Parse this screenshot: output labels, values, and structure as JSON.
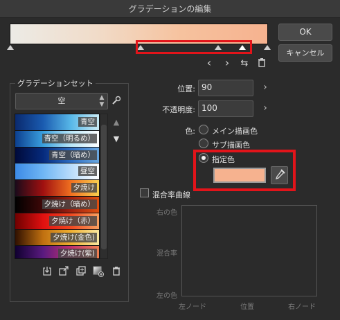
{
  "window": {
    "title": "グラデーションの編集"
  },
  "buttons": {
    "ok": "OK",
    "cancel": "キャンセル"
  },
  "gradient_preview": {
    "colors": [
      "#ecebe6",
      "#f1dcc9",
      "#f6c29e",
      "#f6b28f"
    ]
  },
  "gradient_set": {
    "title": "グラデーションセット",
    "selected": "空",
    "items": [
      {
        "label": "青空",
        "colors": [
          "#0a2a6e",
          "#1a5bb0",
          "#58b8e8",
          "#c9ebf5"
        ]
      },
      {
        "label": "青空（明るめ）",
        "colors": [
          "#0c3f8f",
          "#3aa0df",
          "#b8e6f7",
          "#ffffff"
        ]
      },
      {
        "label": "青空（暗め）",
        "colors": [
          "#000a3a",
          "#062a7c",
          "#2c6cc2",
          "#6aa8e0"
        ]
      },
      {
        "label": "昼空",
        "colors": [
          "#3c8ae6",
          "#6fb6f4",
          "#b9dcfb",
          "#ffffff"
        ]
      },
      {
        "label": "夕焼け",
        "colors": [
          "#1a0a1a",
          "#a01010",
          "#f07020",
          "#f8d050"
        ]
      },
      {
        "label": "夕焼け（暗め）",
        "colors": [
          "#000000",
          "#400808",
          "#a02010",
          "#e05010"
        ]
      },
      {
        "label": "夕焼け（赤）",
        "colors": [
          "#700000",
          "#e01010",
          "#f04820",
          "#f8a060"
        ]
      },
      {
        "label": "夕焼け(金色)",
        "colors": [
          "#301000",
          "#c07010",
          "#f0b030",
          "#f8e8a0"
        ]
      },
      {
        "label": "夕焼け(紫)",
        "colors": [
          "#100030",
          "#5a1a80",
          "#c03070",
          "#f08050"
        ]
      }
    ]
  },
  "position": {
    "label": "位置:",
    "value": "90"
  },
  "opacity": {
    "label": "不透明度:",
    "value": "100"
  },
  "color": {
    "label": "色:",
    "options": [
      "メイン描画色",
      "サブ描画色",
      "指定色"
    ],
    "selected": "指定色",
    "specified_hex": "#f6b28f"
  },
  "blend_curve": {
    "checkbox_label": "混合率曲線",
    "y_top": "右の色",
    "y_mid": "混合率",
    "y_bottom": "左の色",
    "x_left": "左ノード",
    "x_mid": "位置",
    "x_right": "右ノード"
  },
  "icons": {
    "nav": [
      "chevron-left-icon",
      "chevron-right-icon",
      "swap-icon",
      "trash-icon"
    ],
    "set_tools": [
      "import-icon",
      "export-icon",
      "duplicate-icon",
      "add-gradient-icon",
      "trash-icon"
    ]
  }
}
